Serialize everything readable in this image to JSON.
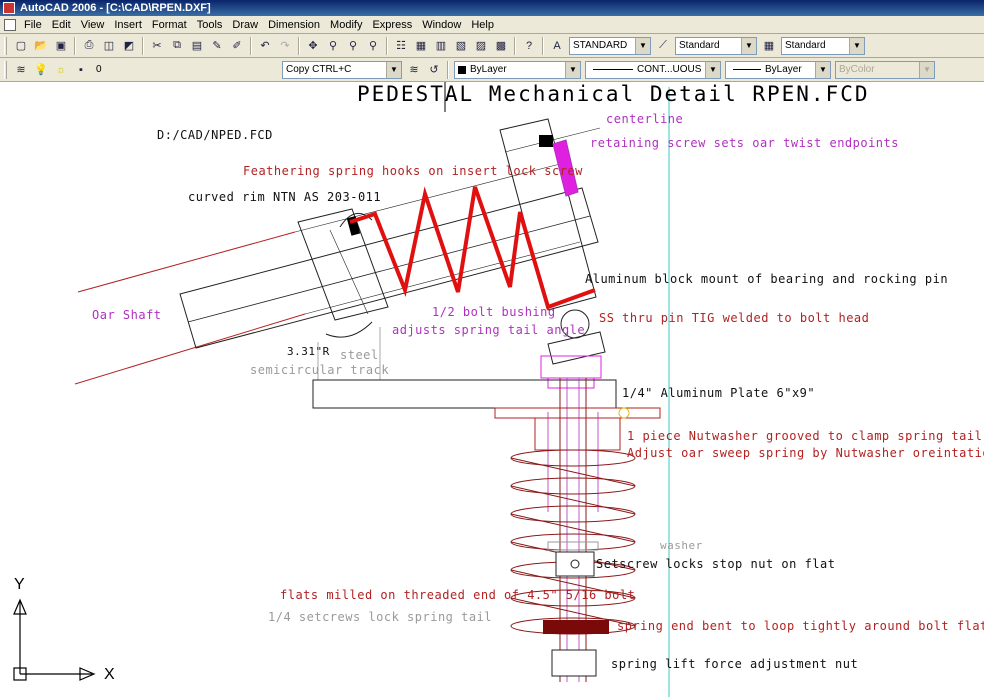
{
  "window": {
    "title": "AutoCAD 2006 - [C:\\CAD\\RPEN.DXF]"
  },
  "menu": [
    "File",
    "Edit",
    "View",
    "Insert",
    "Format",
    "Tools",
    "Draw",
    "Dimension",
    "Modify",
    "Express",
    "Window",
    "Help"
  ],
  "toolbar1": {
    "text_style": "STANDARD",
    "dim_style": "Standard",
    "table_style": "Standard"
  },
  "toolbar2": {
    "layer": "0",
    "copy_field": "Copy   CTRL+C",
    "color": "ByLayer",
    "linetype": "CONT...UOUS",
    "lineweight": "ByLayer",
    "plot_style": "ByColor"
  },
  "drawing": {
    "title": "PEDESTAL Mechanical Detail RPEN.FCD",
    "file_path": "D:/CAD/NPED.FCD",
    "labels": {
      "centerline": "centerline",
      "retaining_screw": "retaining screw sets oar twist endpoints",
      "feathering_spring": "Feathering spring hooks on insert lock screw",
      "curved_rim": "curved rim NTN   AS 203-011",
      "aluminum_block": "Aluminum block mount of bearing and rocking pin",
      "oar_shaft": "Oar Shaft",
      "bolt_bushing": "1/2 bolt bushing",
      "adjusts_spring": "adjusts spring tail angle",
      "ss_thru_pin": "SS thru pin TIG welded to bolt head",
      "radius": "3.31\"R",
      "steel": "steel",
      "semicircular_track": "semicircular track",
      "aluminum_plate": "1/4\" Aluminum Plate 6\"x9\"",
      "nutwasher": "1 piece Nutwasher grooved to clamp spring tail",
      "adjust_oar": "Adjust oar sweep spring by Nutwasher oreintation",
      "washer": "washer",
      "setscrew_locks": "Setscrew locks stop nut on flat",
      "flats_milled": "flats milled on threaded end of 4.5\" 5/16 bolt",
      "setcrews_lock": "1/4 setcrews lock spring tail",
      "spring_end": "spring end bent to loop tightly around bolt flats",
      "spring_lift": "spring lift force adjustment nut"
    },
    "axis": {
      "y": "Y",
      "x": "X"
    }
  },
  "colors": {
    "spring_red": "#e01010",
    "dark_red": "#8b1a1a",
    "magenta": "#e020e0",
    "cyan": "#60d0d0"
  }
}
